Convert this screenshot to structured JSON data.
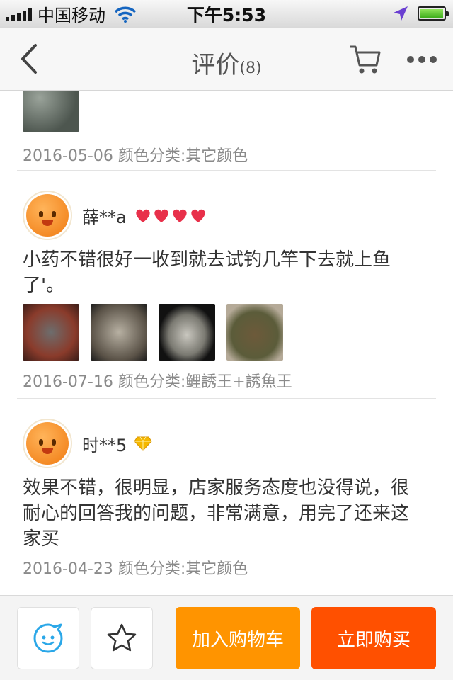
{
  "status_bar": {
    "carrier": "中国移动",
    "time": "下午5:53",
    "icons": [
      "signal-icon",
      "wifi-icon",
      "location-arrow-icon",
      "battery-icon"
    ]
  },
  "nav": {
    "title": "评价",
    "count": "(8)",
    "icons": [
      "back-chevron-icon",
      "cart-icon",
      "more-dots-icon"
    ]
  },
  "reviews": [
    {
      "date_line": "2016-05-06 颜色分类:其它颜色"
    },
    {
      "user": "薛**a",
      "badge_icon": "heart-level-badge-icon",
      "text": "小药不错很好一收到就去试钓几竿下去就上鱼了'。",
      "date_line": "2016-07-16 颜色分类:鲤誘王+誘魚王"
    },
    {
      "user": "时**5",
      "badge_icon": "diamond-level-badge-icon",
      "text": "效果不错，很明显，店家服务态度也没得说，很耐心的回答我的问题，非常满意，用完了还来这家买",
      "date_line": "2016-04-23 颜色分类:其它颜色"
    }
  ],
  "bottom_bar": {
    "add_to_cart": "加入购物车",
    "buy_now": "立即购买",
    "icons": [
      "service-chat-icon",
      "favorite-star-icon"
    ]
  },
  "colors": {
    "add_to_cart": "#ff9400",
    "buy_now": "#ff5000",
    "heart_badge": "#e8304a",
    "diamond_badge": "#f5b800"
  }
}
